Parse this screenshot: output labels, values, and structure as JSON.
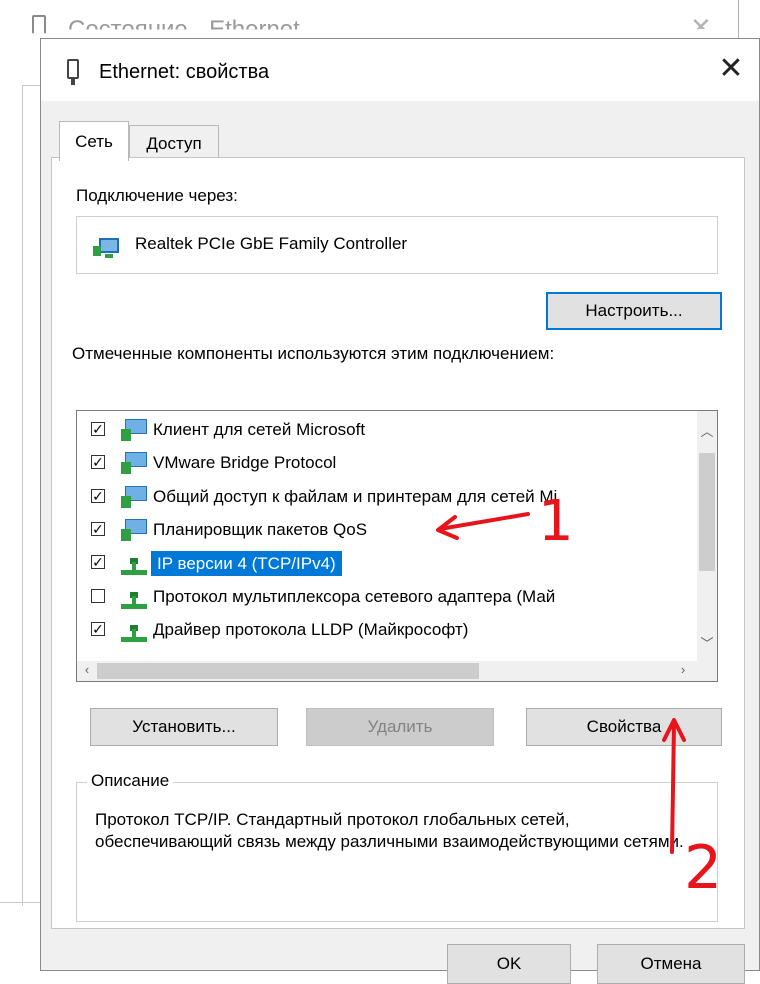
{
  "background_window": {
    "title": "Состояние - Ethernet"
  },
  "dialog": {
    "title": "Ethernet: свойства",
    "close_glyph": "✕",
    "tabs": [
      {
        "label": "Сеть"
      },
      {
        "label": "Доступ"
      }
    ],
    "connect_using_label": "Подключение через:",
    "adapter_name": "Realtek PCIe GbE Family Controller",
    "configure_button": "Настроить...",
    "components_label": "Отмеченные компоненты используются этим подключением:",
    "components": [
      {
        "label": "Клиент для сетей Microsoft",
        "checked": true,
        "icon": "network-client-icon"
      },
      {
        "label": "VMware Bridge Protocol",
        "checked": true,
        "icon": "network-client-icon"
      },
      {
        "label": "Общий доступ к файлам и принтерам для сетей Mi",
        "checked": true,
        "icon": "network-client-icon"
      },
      {
        "label": "Планировщик пакетов QoS",
        "checked": true,
        "icon": "network-client-icon"
      },
      {
        "label": "IP версии 4 (TCP/IPv4)",
        "checked": true,
        "icon": "protocol-icon",
        "selected": true
      },
      {
        "label": "Протокол мультиплексора сетевого адаптера (Май",
        "checked": false,
        "icon": "protocol-icon"
      },
      {
        "label": "Драйвер протокола LLDP (Майкрософт)",
        "checked": true,
        "icon": "protocol-icon"
      }
    ],
    "install_button": "Установить...",
    "remove_button": "Удалить",
    "properties_button": "Свойства",
    "description_title": "Описание",
    "description_text": "Протокол TCP/IP. Стандартный протокол глобальных сетей, обеспечивающий связь между различными взаимодействующими сетями.",
    "ok_button": "OK",
    "cancel_button": "Отмена"
  },
  "annotations": {
    "label_1": "1",
    "label_2": "2",
    "color": "#e8141c"
  },
  "colors": {
    "selection": "#0078d7",
    "focus_border": "#0078d7",
    "dialog_bg": "#f0f0f0"
  }
}
